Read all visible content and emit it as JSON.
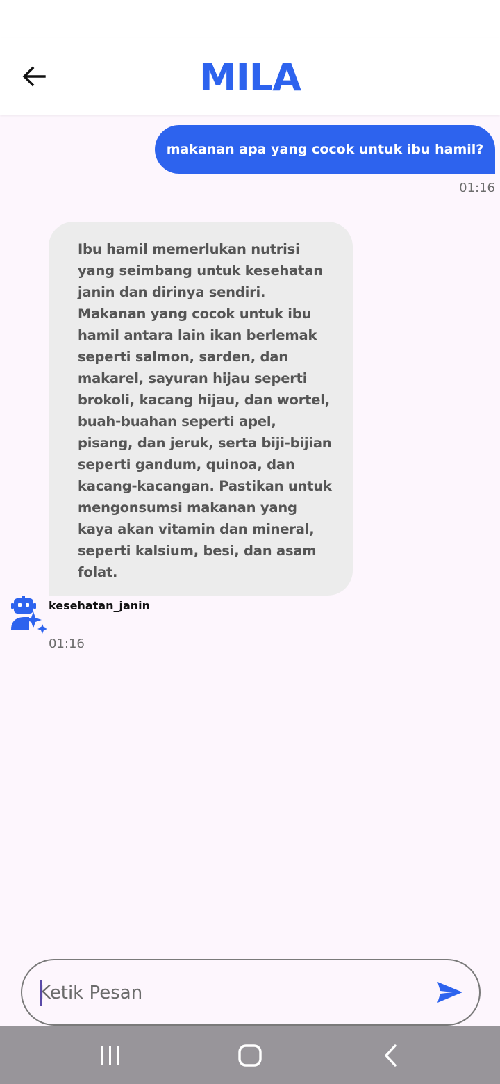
{
  "header": {
    "title": "MILA",
    "back_icon": "arrow-left-icon"
  },
  "messages": [
    {
      "sender": "user",
      "text": "makanan apa yang cocok untuk ibu hamil?",
      "time": "01:16"
    },
    {
      "sender": "bot",
      "text": "Ibu hamil memerlukan nutrisi yang seimbang untuk kesehatan janin dan dirinya sendiri. Makanan yang cocok untuk ibu hamil antara lain ikan berlemak seperti salmon, sarden, dan makarel, sayuran hijau seperti brokoli, kacang hijau, dan wortel, buah-buahan seperti apel, pisang, dan jeruk, serta biji-bijian seperti gandum, quinoa, dan kacang-kacangan. Pastikan untuk mengonsumsi makanan yang kaya akan vitamin dan mineral, seperti kalsium, besi, dan asam folat.",
      "name": "kesehatan_janin",
      "time": "01:16",
      "avatar_icon": "robot-sparkle-icon"
    }
  ],
  "composer": {
    "placeholder": "Ketik Pesan",
    "send_icon": "send-icon"
  },
  "colors": {
    "accent": "#2d63ee",
    "background": "#fdf6fd",
    "bot_bubble": "#ececec",
    "navbar": "#98959a"
  },
  "system_nav": {
    "recents_icon": "recents-icon",
    "home_icon": "home-icon",
    "back_icon": "nav-back-icon"
  }
}
